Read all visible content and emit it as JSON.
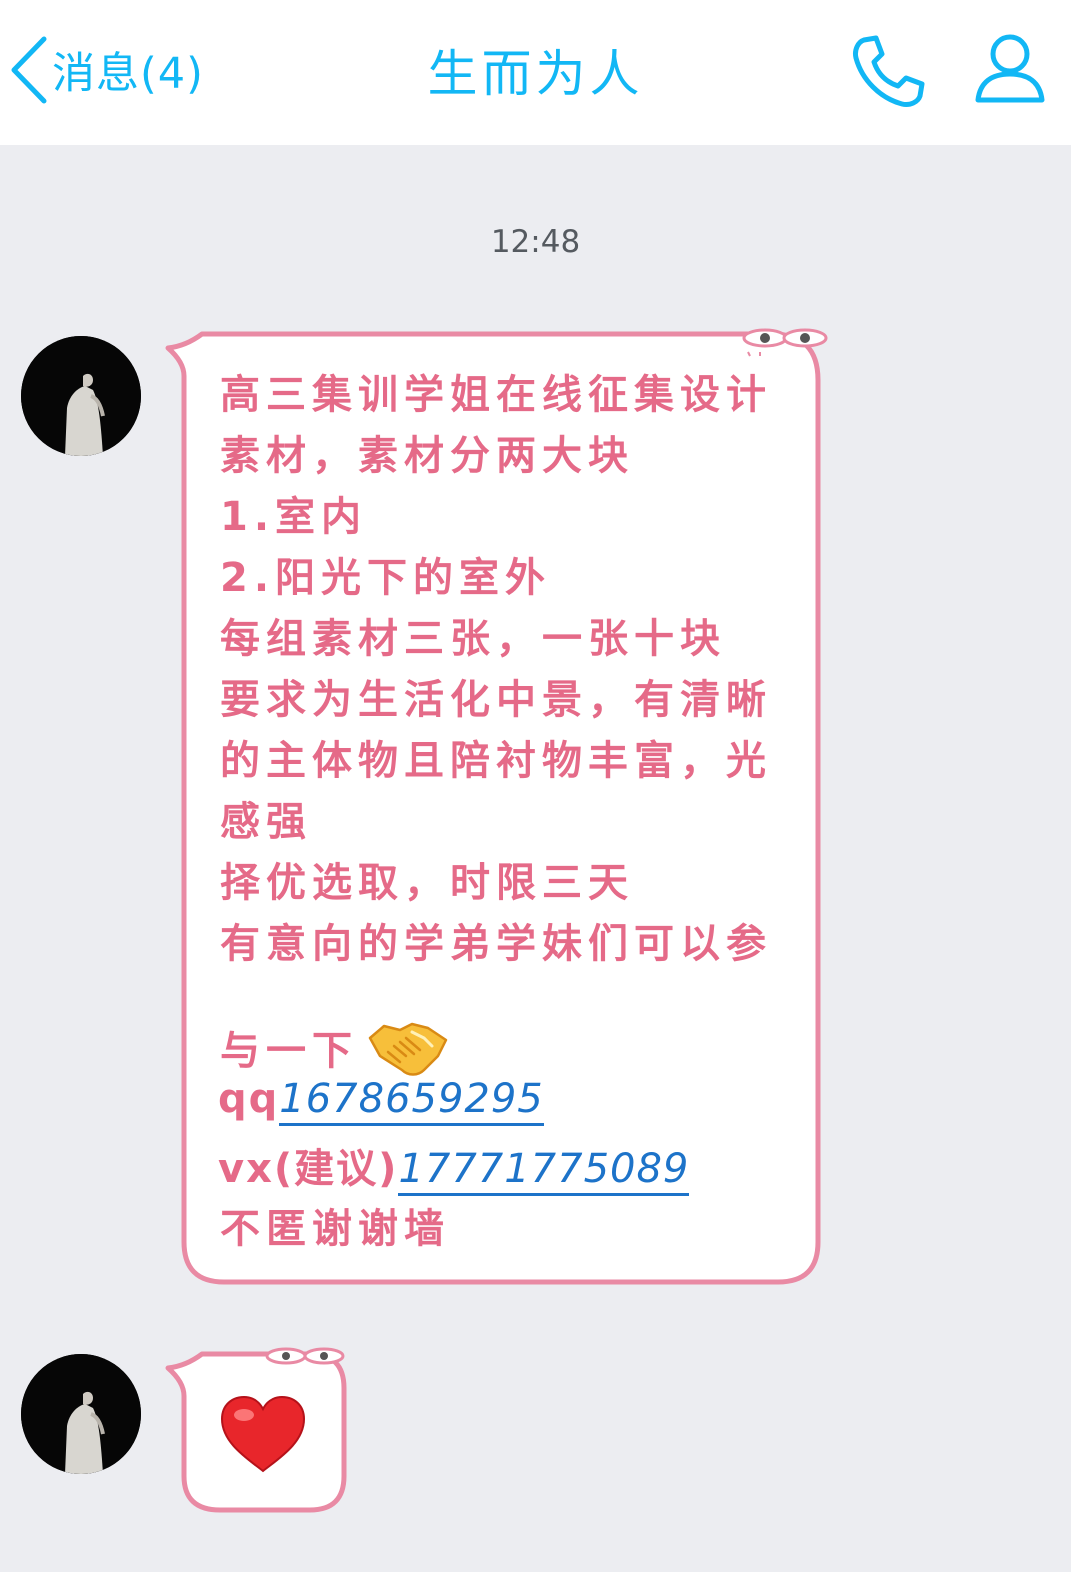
{
  "header": {
    "back_label": "消息(4)",
    "title": "生而为人",
    "icons": {
      "back": "chevron-left-icon",
      "phone": "phone-icon",
      "profile": "profile-icon"
    },
    "accent_color": "#12b7f5"
  },
  "chat": {
    "timestamp": "12:48",
    "message1": {
      "lines": [
        "高三集训学姐在线征集设计",
        "素材，素材分两大块",
        "1.室内",
        "2.阳光下的室外",
        "每组素材三张，一张十块",
        "要求为生活化中景，有清晰",
        "的主体物且陪衬物丰富，光",
        "感强",
        "择优选取，时限三天",
        "有意向的学弟学妹们可以参"
      ],
      "emoji_line": "与一下",
      "emoji": "handshake-icon",
      "qq_prefix": "qq",
      "qq_number": "1678659295",
      "vx_prefix": "vx(建议)",
      "vx_number": "17771775089",
      "closing": "不匿谢谢墙",
      "text_color": "#e56a88",
      "link_color": "#1d73c9"
    },
    "message2": {
      "emoji": "heart-icon"
    }
  }
}
